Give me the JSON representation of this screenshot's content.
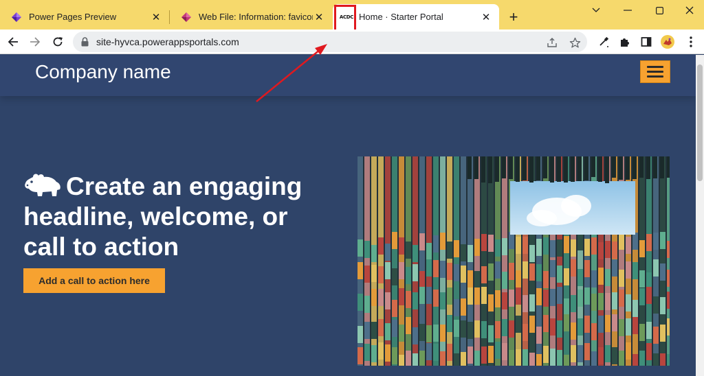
{
  "browser": {
    "tabs": [
      {
        "title": "Power Pages Preview",
        "favicon": "power-pages-icon",
        "active": false
      },
      {
        "title": "Web File: Information: favicon.ico",
        "favicon": "power-pages-icon",
        "active": false
      },
      {
        "title": "Home · Starter Portal",
        "favicon_text": "ACDC",
        "active": true
      }
    ],
    "url": "site-hyvca.powerappsportals.com",
    "new_tab_label": "+"
  },
  "site": {
    "company_name": "Company name",
    "headline": "Create an engaging headline, welcome, or call to action",
    "cta_label": "Add a call to action here"
  },
  "colors": {
    "tab_strip": "#f6d96c",
    "page_bg": "#2f4469",
    "accent": "#f7a230",
    "annotation": "#e0191f"
  }
}
